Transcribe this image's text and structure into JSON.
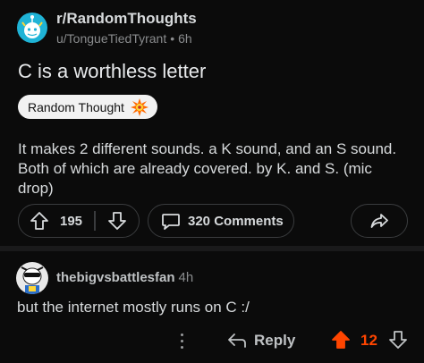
{
  "post": {
    "subreddit": "r/RandomThoughts",
    "author": "u/TongueTiedTyrant",
    "separator": "•",
    "age": "6h",
    "title": "C is a worthless letter",
    "flair": "Random Thought",
    "body": "It makes 2 different sounds. a K sound, and an S sound. Both of which are already covered. by K. and S. (mic drop)",
    "score": "195",
    "comments_label": "320 Comments"
  },
  "comment": {
    "author": "thebigvsbattlesfan",
    "age": "4h",
    "text": "but the internet mostly runs on C :/",
    "reply_label": "Reply",
    "score": "12",
    "upvoted": true
  },
  "colors": {
    "background": "#0b0b0b",
    "upvote_accent": "#ff4500",
    "flair_bg": "#f2f2f2",
    "sub_avatar": "#1fb3d6"
  }
}
